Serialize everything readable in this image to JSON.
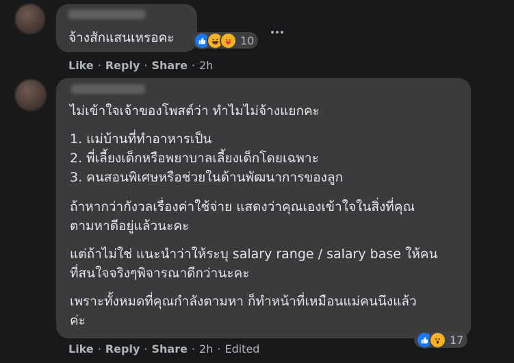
{
  "comment1": {
    "text": "จ้างสักแสนเหรอคะ",
    "reaction_icons": [
      "like-icon",
      "haha-icon",
      "care-icon"
    ],
    "reaction_count": "10",
    "actions": {
      "like": "Like",
      "reply": "Reply",
      "share": "Share",
      "time": "2h"
    }
  },
  "comment2": {
    "lines": [
      "ไม่เข้าใจเจ้าของโพสต์ว่า ทำไมไม่จ้างแยกคะ",
      "1. แม่บ้านที่ทำอาหารเป็น",
      "2. พี่เลี้ยงเด็กหรือพยาบาลเลี้ยงเด็กโดยเฉพาะ",
      "3. คนสอนพิเศษหรือช่วยในด้านพัฒนาการของลูก",
      "ถ้าหากว่ากังวลเรื่องค่าใช้จ่าย แสดงว่าคุณเองเข้าใจในสิ่งที่คุณ",
      "ตามหาดีอยู่แล้วนะคะ",
      "แต่ถ้าไม่ใช่ แนะนำว่าให้ระบุ salary range / salary base ให้คน",
      "ที่สนใจจริงๆพิจารณาดีกว่านะคะ",
      "เพราะทั้งหมดที่คุณกำลังตามหา ก็ทำหน้าที่เหมือนแม่คนนึงแล้ว",
      "ค่ะ"
    ],
    "reaction_icons": [
      "like-icon",
      "wow-icon"
    ],
    "reaction_count": "17",
    "actions": {
      "like": "Like",
      "reply": "Reply",
      "share": "Share",
      "time": "2h",
      "edited": "Edited"
    }
  },
  "colors": {
    "background": "#18191a",
    "bubble": "#3a3b3c",
    "text": "#e4e6eb",
    "secondary_text": "#b0b3b8",
    "like_blue": "#1877f2",
    "emoji_yellow": "#f7b125"
  }
}
